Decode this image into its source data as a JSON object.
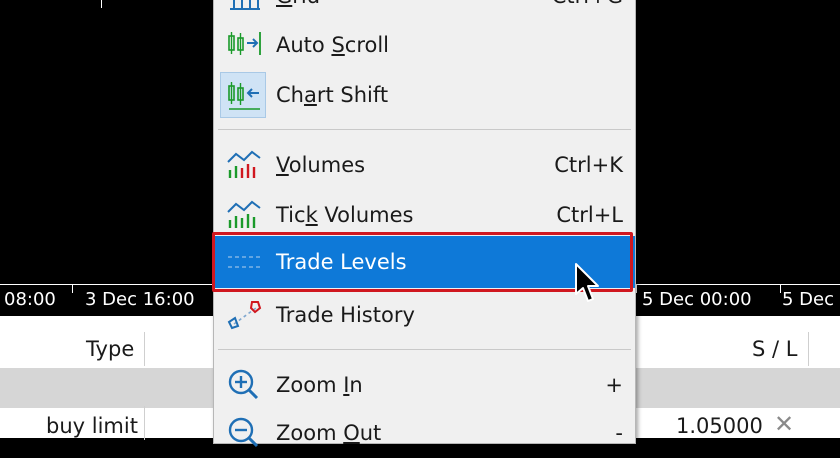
{
  "axis": {
    "labels": [
      "08:00",
      "3 Dec 16:00",
      "5 Dec 00:00",
      "5 Dec"
    ]
  },
  "table": {
    "headers": {
      "type": "Type",
      "sl": "S / L"
    },
    "row": {
      "type": "buy limit",
      "sl": "1.05000"
    }
  },
  "menu": {
    "items": [
      {
        "label_pre": "",
        "label_u": "G",
        "label_post": "rid",
        "shortcut": "Ctrl+G",
        "icon": "grid-icon"
      },
      {
        "label_pre": "Auto ",
        "label_u": "S",
        "label_post": "croll",
        "shortcut": "",
        "icon": "auto-scroll-icon"
      },
      {
        "label_pre": "Ch",
        "label_u": "a",
        "label_post": "rt Shift",
        "shortcut": "",
        "icon": "chart-shift-icon"
      },
      {
        "label_pre": "",
        "label_u": "V",
        "label_post": "olumes",
        "shortcut": "Ctrl+K",
        "icon": "volumes-icon"
      },
      {
        "label_pre": "Tic",
        "label_u": "k",
        "label_post": " Volumes",
        "shortcut": "Ctrl+L",
        "icon": "tick-volumes-icon"
      },
      {
        "label": "Trade Levels",
        "shortcut": "",
        "icon": "trade-levels-icon"
      },
      {
        "label": "Trade History",
        "shortcut": "",
        "icon": "trade-history-icon"
      },
      {
        "label_pre": "Zoom ",
        "label_u": "I",
        "label_post": "n",
        "shortcut": "+",
        "icon": "zoom-in-icon"
      },
      {
        "label_pre": "Zoom ",
        "label_u": "O",
        "label_post": "ut",
        "shortcut": "-",
        "icon": "zoom-out-icon"
      }
    ]
  },
  "colors": {
    "highlight": "#0e79d8",
    "outline": "#d0171f"
  }
}
